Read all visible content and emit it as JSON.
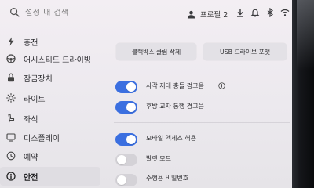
{
  "search": {
    "placeholder": "설정 내 검색"
  },
  "profile": {
    "label": "프로필 2"
  },
  "sidebar": {
    "items": [
      {
        "label": "충전",
        "icon": "charging-bolt-icon"
      },
      {
        "label": "어시스티드 드라이빙",
        "icon": "steering-wheel-icon"
      },
      {
        "label": "잠금장치",
        "icon": "lock-icon"
      },
      {
        "label": "라이트",
        "icon": "sun-icon"
      },
      {
        "label": "좌석",
        "icon": "seat-icon"
      },
      {
        "label": "디스플레이",
        "icon": "display-icon"
      },
      {
        "label": "예약",
        "icon": "clock-icon"
      },
      {
        "label": "안전",
        "icon": "safety-info-icon",
        "active": true
      }
    ]
  },
  "actions": {
    "dashcam_delete": "블랙박스 클립 삭제",
    "usb_format": "USB 드라이브 포맷"
  },
  "options": [
    {
      "label": "사각 지대 충돌 경고음",
      "enabled": true
    },
    {
      "label": "후방 교차 통행 경고음",
      "enabled": true
    },
    {
      "label": "모바일 액세스 허용",
      "enabled": true
    },
    {
      "label": "발렛 모드",
      "enabled": false
    },
    {
      "label": "주행용 비밀번호",
      "enabled": false
    }
  ],
  "colors": {
    "accent": "#3b6fe0",
    "toggle_off": "#d4d2d7",
    "active_row": "#dfdde2"
  }
}
